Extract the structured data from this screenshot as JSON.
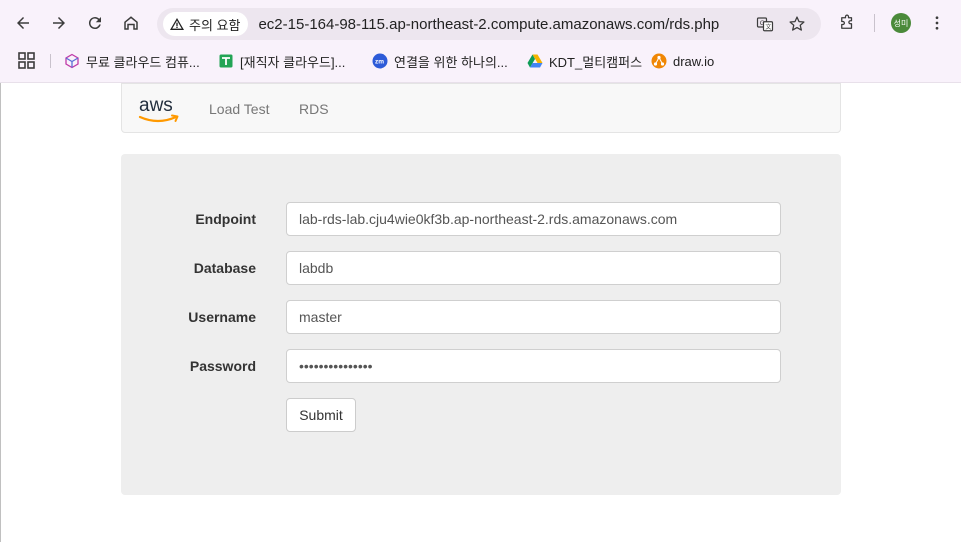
{
  "browser": {
    "security_label": "주의 요함",
    "url": "ec2-15-164-98-115.ap-northeast-2.compute.amazonaws.com/rds.php",
    "profile_initials": "성미"
  },
  "bookmarks": [
    {
      "label": "무료 클라우드 컴퓨...",
      "icon": "cube-icon"
    },
    {
      "label": "[재직자 클라우드]...",
      "icon": "sheets-icon"
    },
    {
      "label": "연결을 위한 하나의...",
      "icon": "zoom-icon"
    },
    {
      "label": "KDT_멀티캠퍼스",
      "icon": "drive-icon"
    },
    {
      "label": "draw.io",
      "icon": "drawio-icon"
    }
  ],
  "navbar": {
    "logo_text": "aws",
    "links": [
      "Load Test",
      "RDS"
    ]
  },
  "form": {
    "endpoint_label": "Endpoint",
    "endpoint_value": "lab-rds-lab.cju4wie0kf3b.ap-northeast-2.rds.amazonaws.com",
    "database_label": "Database",
    "database_value": "labdb",
    "username_label": "Username",
    "username_value": "master",
    "password_label": "Password",
    "password_value": "•••••••••••••••",
    "submit_label": "Submit"
  }
}
